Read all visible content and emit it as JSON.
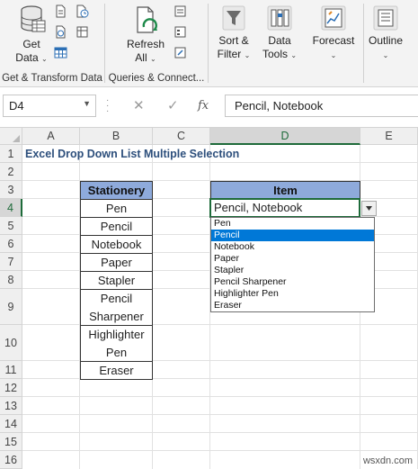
{
  "ribbon": {
    "get_data": {
      "label_line1": "Get",
      "label_line2": "Data"
    },
    "refresh_all": {
      "label_line1": "Refresh",
      "label_line2": "All"
    },
    "sort_filter": {
      "label_line1": "Sort &",
      "label_line2": "Filter"
    },
    "data_tools": {
      "label_line1": "Data",
      "label_line2": "Tools"
    },
    "forecast": {
      "label": "Forecast"
    },
    "outline": {
      "label": "Outline"
    },
    "group_labels": {
      "get_transform": "Get & Transform Data",
      "queries": "Queries & Connect..."
    },
    "dropdown_glyph": "⌄"
  },
  "formula_bar": {
    "name_box": "D4",
    "cancel_symbol": "✕",
    "enter_symbol": "✓",
    "fx_symbol": "fx",
    "value": "Pencil, Notebook"
  },
  "grid": {
    "columns": [
      "A",
      "B",
      "C",
      "D",
      "E"
    ],
    "rows": [
      "1",
      "2",
      "3",
      "4",
      "5",
      "6",
      "7",
      "8",
      "9",
      "10",
      "11",
      "12",
      "13",
      "14",
      "15",
      "16"
    ],
    "active_column": "D",
    "active_row": "4"
  },
  "sheet": {
    "title": "Excel Drop Down List Multiple Selection",
    "stationery_header": "Stationery",
    "stationery": [
      "Pen",
      "Pencil",
      "Notebook",
      "Paper",
      "Stapler",
      "Pencil Sharpener",
      "Highlighter Pen",
      "Eraser"
    ],
    "item_header": "Item",
    "item_value": "Pencil, Notebook"
  },
  "dropdown": {
    "options": [
      "Pen",
      "Pencil",
      "Notebook",
      "Paper",
      "Stapler",
      "Pencil Sharpener",
      "Highlighter Pen",
      "Eraser"
    ],
    "highlighted": "Pencil"
  },
  "watermark": "wsxdn.com",
  "colors": {
    "header_fill": "#8eaadb",
    "title_text": "#2d4f7c",
    "active_border": "#1e6b3a",
    "selection_blue": "#0078d7"
  }
}
